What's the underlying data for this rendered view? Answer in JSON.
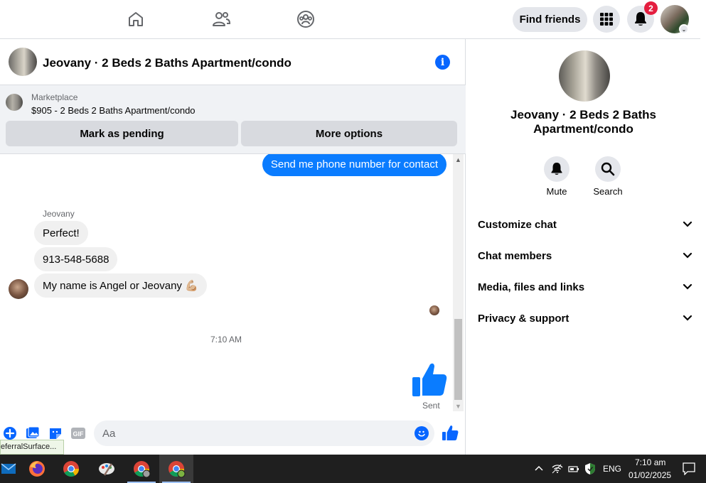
{
  "topbar": {
    "find_friends_label": "Find friends",
    "notification_count": "2",
    "nav_icons": [
      "home-icon",
      "friends-icon",
      "groups-icon"
    ]
  },
  "chat": {
    "title": "Jeovany · 2 Beds 2 Baths Apartment/condo",
    "marketplace": {
      "label": "Marketplace",
      "description": "$905 - 2 Beds 2 Baths Apartment/condo",
      "pending_button": "Mark as pending",
      "more_button": "More options"
    },
    "messages": {
      "outgoing_text": "Send me phone number for contact",
      "sender_name": "Jeovany",
      "incoming": [
        "Perfect!",
        "913-548-5688",
        "My name is Angel or Jeovany 💪🏼"
      ],
      "timestamp": "7:10 AM",
      "sent_status": "Sent"
    },
    "composer": {
      "placeholder": "Aa",
      "gif_label": "GIF"
    }
  },
  "status_tooltip": "eferralSurface...",
  "info_panel": {
    "name": "Jeovany · 2 Beds 2 Baths Apartment/condo",
    "actions": {
      "mute": "Mute",
      "search": "Search"
    },
    "sections": [
      "Customize chat",
      "Chat members",
      "Media, files and links",
      "Privacy & support"
    ]
  },
  "taskbar": {
    "apps": [
      "mail",
      "firefox",
      "chrome",
      "paint",
      "chrome-profile",
      "chrome-profile-active"
    ],
    "language": "ENG",
    "time": "7:10 am",
    "date": "01/02/2025"
  },
  "colors": {
    "messenger_blue": "#0a7cff",
    "facebook_blue": "#0866ff",
    "notification_red": "#e41e3f",
    "taskbar": "#1f1f1f"
  }
}
